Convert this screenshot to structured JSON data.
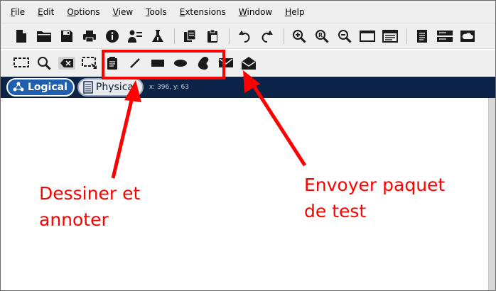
{
  "menubar": {
    "items": [
      {
        "mnemonic": "F",
        "rest": "ile"
      },
      {
        "mnemonic": "E",
        "rest": "dit"
      },
      {
        "mnemonic": "O",
        "rest": "ptions"
      },
      {
        "mnemonic": "V",
        "rest": "iew"
      },
      {
        "mnemonic": "T",
        "rest": "ools"
      },
      {
        "mnemonic": "E",
        "rest": "xtensions"
      },
      {
        "mnemonic": "W",
        "rest": "indow"
      },
      {
        "mnemonic": "H",
        "rest": "elp"
      }
    ]
  },
  "toolbar1": {
    "icons": [
      "new-file-icon",
      "open-folder-icon",
      "save-icon",
      "print-icon",
      "info-icon",
      "activity-wizard-icon",
      "lab-flask-icon",
      "copy-icon",
      "paste-icon",
      "undo-icon",
      "redo-icon",
      "zoom-in-icon",
      "zoom-reset-icon",
      "zoom-out-icon",
      "window-icon",
      "palette-icon",
      "notes-icon",
      "device-icon",
      "cloud-icon"
    ]
  },
  "toolbar2": {
    "icons": [
      "select-icon",
      "inspect-icon",
      "delete-icon",
      "resize-icon",
      "note-icon",
      "line-icon",
      "rectangle-icon",
      "ellipse-icon",
      "freeform-icon",
      "simple-pdu-icon",
      "complex-pdu-icon"
    ]
  },
  "workspace": {
    "tabs": [
      {
        "label": "Logical"
      },
      {
        "label": "Physical"
      }
    ],
    "coords": "x: 396, y: 63"
  },
  "annotations": {
    "draw": {
      "line1": "Dessiner et",
      "line2": "annoter"
    },
    "send": {
      "line1": "Envoyer paquet",
      "line2": "de test"
    },
    "color": "#ff0000"
  },
  "colors": {
    "tabbar_bg": "#0b2346",
    "logical_tab_bg": "#1f5fae",
    "annotation": "#ff0000"
  }
}
